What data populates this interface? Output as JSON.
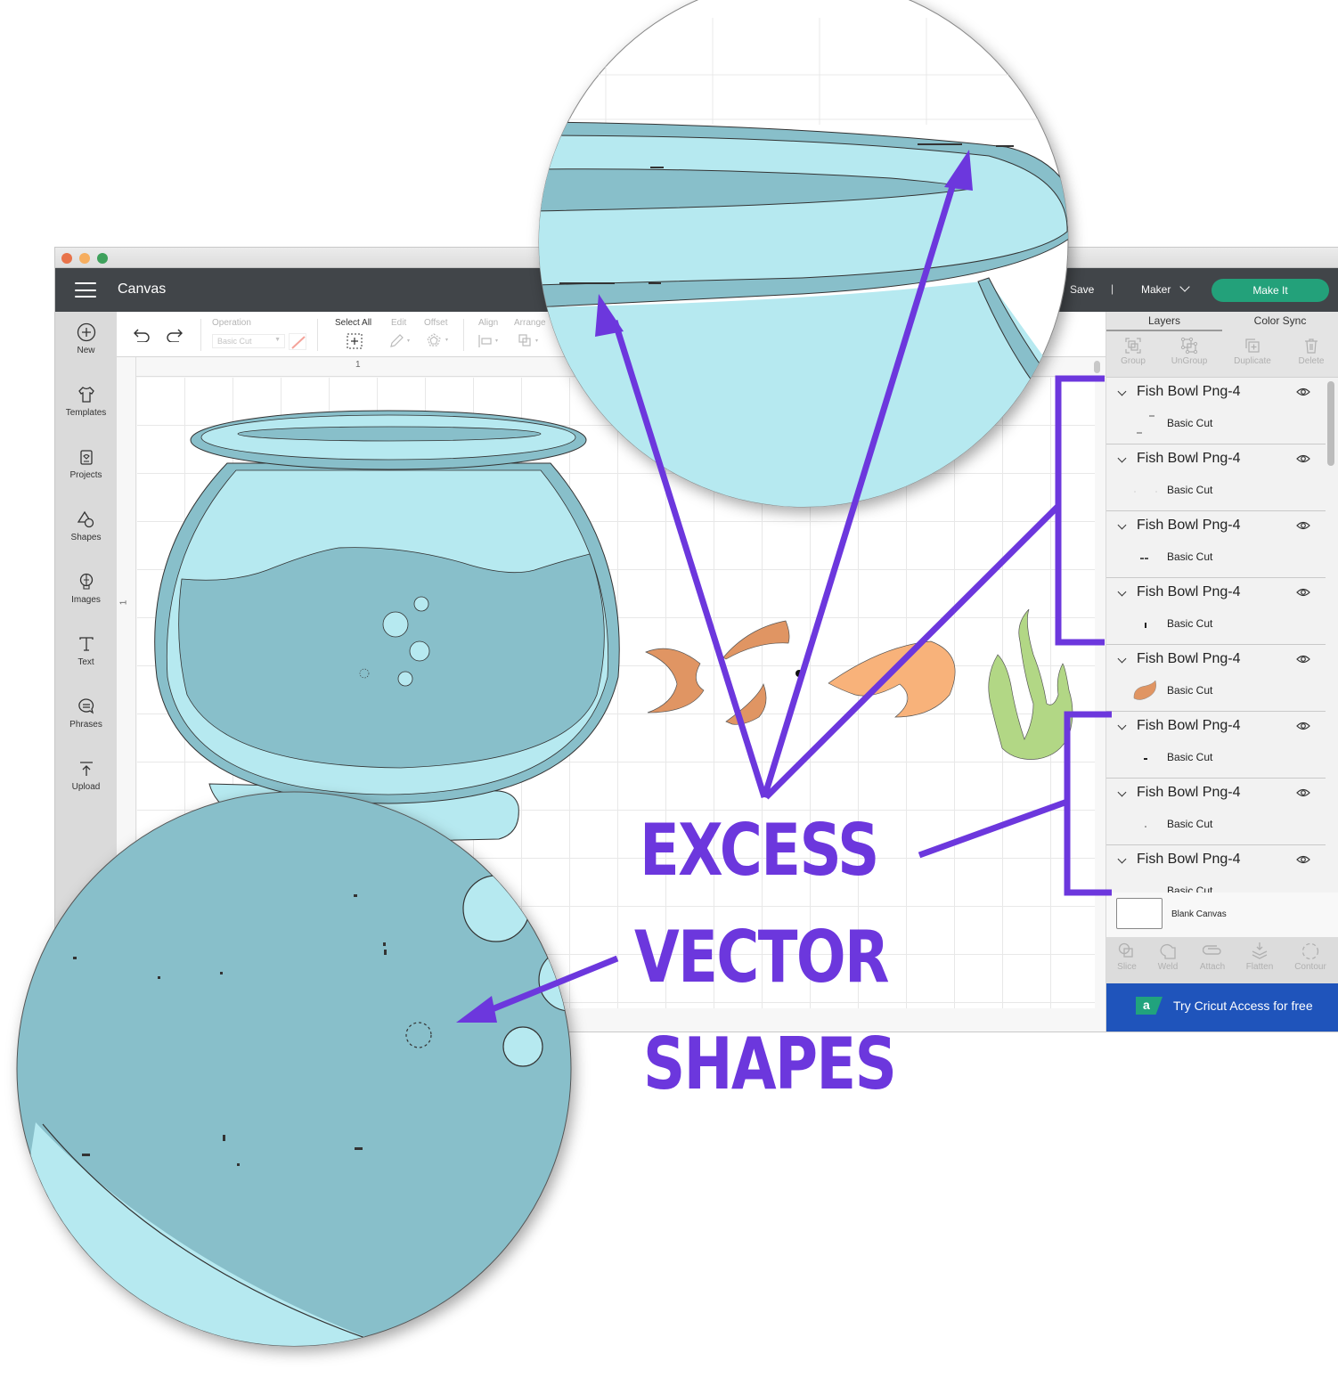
{
  "window": {
    "app_title": "Canvas",
    "save_label": "Save",
    "separator": "|",
    "machine_select": "Maker",
    "make_it_label": "Make It"
  },
  "leftnav": {
    "items": [
      {
        "label": "New",
        "icon": "plus-circle-icon"
      },
      {
        "label": "Templates",
        "icon": "tshirt-icon"
      },
      {
        "label": "Projects",
        "icon": "projects-icon"
      },
      {
        "label": "Shapes",
        "icon": "shapes-icon"
      },
      {
        "label": "Images",
        "icon": "lightbulb-icon"
      },
      {
        "label": "Text",
        "icon": "text-icon"
      },
      {
        "label": "Phrases",
        "icon": "speech-bubble-icon"
      },
      {
        "label": "Upload",
        "icon": "upload-icon"
      }
    ]
  },
  "toolbar": {
    "operation_label": "Operation",
    "operation_value": "Basic Cut",
    "select_all_label": "Select All",
    "edit_label": "Edit",
    "offset_label": "Offset",
    "align_label": "Align",
    "arrange_label": "Arrange"
  },
  "canvas": {
    "ruler_top_mark": "1",
    "ruler_left_mark": "1"
  },
  "right_panel": {
    "tabs": [
      "Layers",
      "Color Sync"
    ],
    "actions": [
      "Group",
      "UnGroup",
      "Duplicate",
      "Delete"
    ],
    "layers": [
      {
        "name": "Fish Bowl Png-4",
        "operation": "Basic Cut",
        "thumb": "dashes"
      },
      {
        "name": "Fish Bowl Png-4",
        "operation": "Basic Cut",
        "thumb": "dots"
      },
      {
        "name": "Fish Bowl Png-4",
        "operation": "Basic Cut",
        "thumb": "double-dash"
      },
      {
        "name": "Fish Bowl Png-4",
        "operation": "Basic Cut",
        "thumb": "tick"
      },
      {
        "name": "Fish Bowl Png-4",
        "operation": "Basic Cut",
        "thumb": "orange-fin"
      },
      {
        "name": "Fish Bowl Png-4",
        "operation": "Basic Cut",
        "thumb": "dash"
      },
      {
        "name": "Fish Bowl Png-4",
        "operation": "Basic Cut",
        "thumb": "dot"
      },
      {
        "name": "Fish Bowl Png-4",
        "operation": "Basic Cut",
        "thumb": "dot"
      }
    ],
    "blank_canvas_label": "Blank Canvas",
    "bottom_actions": [
      "Slice",
      "Weld",
      "Attach",
      "Flatten",
      "Contour"
    ],
    "access_logo": "a",
    "access_banner": "Try Cricut Access for free"
  },
  "annotation": {
    "lines": [
      "EXCESS",
      "VECTOR",
      "SHAPES"
    ],
    "color": "#6c37dd"
  },
  "colors": {
    "bowl_light": "#b6e9f0",
    "bowl_dark": "#88bfca",
    "fish_dark": "#e09563",
    "fish_light": "#f8b27a",
    "seaweed": "#b2d785",
    "make_it": "#23a17a",
    "access_blue": "#1f54bb"
  }
}
